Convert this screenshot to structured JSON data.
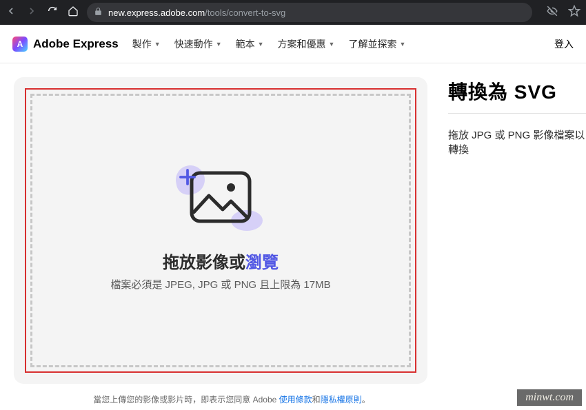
{
  "browser": {
    "url_domain": "new.express.adobe.com",
    "url_path": "/tools/convert-to-svg"
  },
  "header": {
    "brand": "Adobe Express",
    "brand_letter": "A",
    "nav": [
      {
        "label": "製作"
      },
      {
        "label": "快速動作"
      },
      {
        "label": "範本"
      },
      {
        "label": "方案和優惠"
      },
      {
        "label": "了解並探索"
      }
    ],
    "login": "登入"
  },
  "upload": {
    "title_prefix": "拖放影像或",
    "title_browse": "瀏覽",
    "subtitle": "檔案必須是 JPEG, JPG 或 PNG 且上限為 17MB"
  },
  "right": {
    "title": "轉換為 SVG",
    "desc": "拖放 JPG 或 PNG 影像檔案以轉換"
  },
  "footer": {
    "prefix": "當您上傳您的影像或影片時，即表示您同意 Adobe ",
    "terms": "使用條款",
    "and": "和",
    "privacy": "隱私權原則",
    "suffix": "。"
  },
  "watermark": "minwt.com"
}
